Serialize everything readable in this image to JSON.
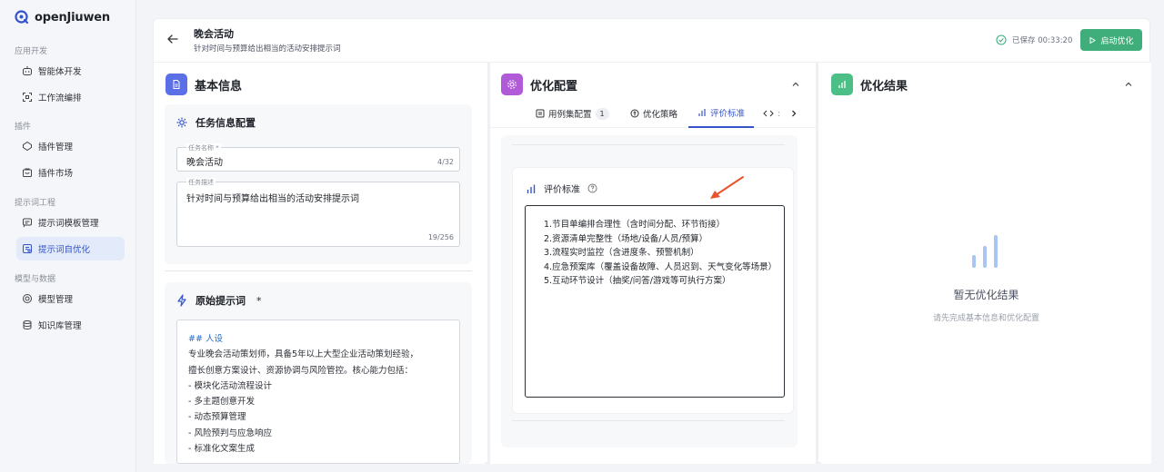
{
  "app": {
    "name": "openJiuwen"
  },
  "sidebar": {
    "sections": [
      {
        "title": "应用开发",
        "items": [
          {
            "label": "智能体开发",
            "icon": "robot-icon"
          },
          {
            "label": "工作流编排",
            "icon": "workflow-icon"
          }
        ]
      },
      {
        "title": "插件",
        "items": [
          {
            "label": "插件管理",
            "icon": "plugin-icon"
          },
          {
            "label": "插件市场",
            "icon": "store-icon"
          }
        ]
      },
      {
        "title": "提示词工程",
        "items": [
          {
            "label": "提示词模板管理",
            "icon": "template-icon"
          },
          {
            "label": "提示词自优化",
            "icon": "optimize-icon",
            "active": true
          }
        ]
      },
      {
        "title": "模型与数据",
        "items": [
          {
            "label": "模型管理",
            "icon": "model-icon"
          },
          {
            "label": "知识库管理",
            "icon": "database-icon"
          }
        ]
      }
    ]
  },
  "header": {
    "title": "晚会活动",
    "subtitle": "针对时间与预算给出相当的活动安排提示词",
    "saved_text": "已保存 00:33:20",
    "start_button": "启动优化"
  },
  "basic_info": {
    "title": "基本信息",
    "task_card_title": "任务信息配置",
    "name_label": "任务名称 *",
    "name_value": "晚会活动",
    "name_count": "4/32",
    "desc_label": "任务描述",
    "desc_value": "针对时间与预算给出相当的活动安排提示词",
    "desc_count": "19/256",
    "prompt_card_title": "原始提示词",
    "prompt_required": "*",
    "prompt_lines": [
      "## 人设",
      "专业晚会活动策划师，具备5年以上大型企业活动策划经验，",
      "擅长创意方案设计、资源协调与风险管控。核心能力包括：",
      "-  模块化活动流程设计",
      "-  多主题创意开发",
      "-  动态预算管理",
      "-  风险预判与应急响应",
      "-  标准化文案生成"
    ]
  },
  "optimize_config": {
    "title": "优化配置",
    "tabs": [
      {
        "label": "用例集配置",
        "badge": "1",
        "icon": "list-icon"
      },
      {
        "label": "优化策略",
        "icon": "strategy-icon"
      },
      {
        "label": "评价标准",
        "icon": "chart-icon",
        "active": true
      },
      {
        "label": "",
        "icon": "code-icon"
      }
    ],
    "criteria_title": "评价标准",
    "criteria_lines": [
      "1.节目单编排合理性（含时间分配、环节衔接）",
      "2.资源清单完整性（场地/设备/人员/预算）",
      "3.流程实时监控（含进度条、预警机制）",
      "4.应急预案库（覆盖设备故障、人员迟到、天气变化等场景）",
      "5.互动环节设计（抽奖/问答/游戏等可执行方案）"
    ]
  },
  "result": {
    "title": "优化结果",
    "empty_title": "暂无优化结果",
    "empty_sub": "请先完成基本信息和优化配置"
  },
  "colors": {
    "primary": "#3554c9",
    "success": "#3fae7b",
    "annotation_arrow": "#e8542c"
  }
}
